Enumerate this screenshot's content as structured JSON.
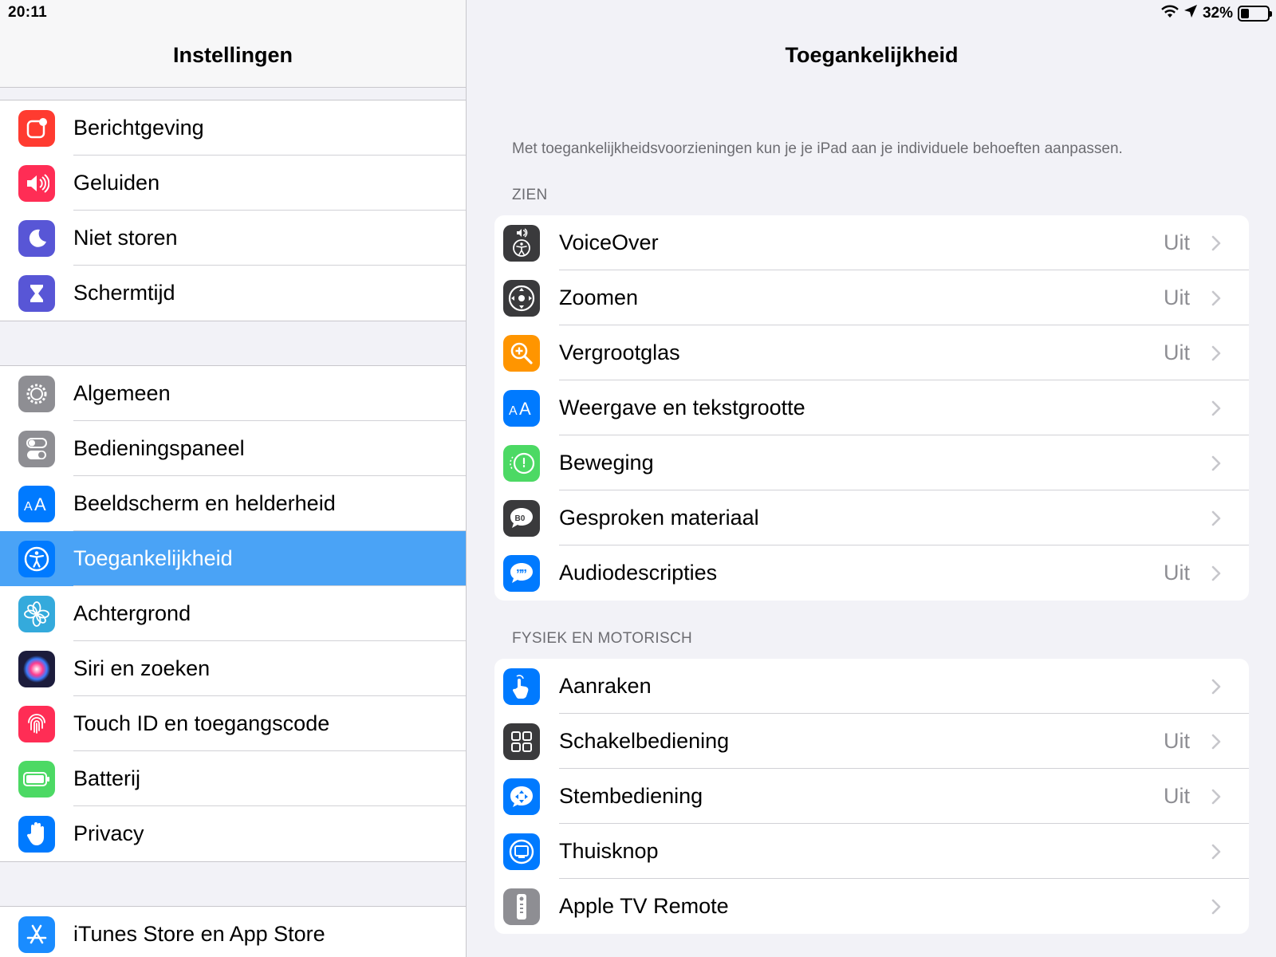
{
  "status": {
    "time": "20:11",
    "battery": "32%",
    "battery_level": 0.32
  },
  "sidebar": {
    "title": "Instellingen",
    "groups": [
      [
        {
          "label": "Berichtgeving",
          "icon": "notifications-icon",
          "color": "#ff3b30"
        },
        {
          "label": "Geluiden",
          "icon": "speaker-icon",
          "color": "#ff2d55"
        },
        {
          "label": "Niet storen",
          "icon": "moon-icon",
          "color": "#5856d6"
        },
        {
          "label": "Schermtijd",
          "icon": "hourglass-icon",
          "color": "#5856d6"
        }
      ],
      [
        {
          "label": "Algemeen",
          "icon": "gear-icon",
          "color": "#8e8e93"
        },
        {
          "label": "Bedieningspaneel",
          "icon": "toggles-icon",
          "color": "#8e8e93"
        },
        {
          "label": "Beeldscherm en helderheid",
          "icon": "text-size-icon",
          "color": "#007aff"
        },
        {
          "label": "Toegankelijkheid",
          "icon": "accessibility-icon",
          "color": "#007aff",
          "selected": true
        },
        {
          "label": "Achtergrond",
          "icon": "flower-icon",
          "color": "#34aadc"
        },
        {
          "label": "Siri en zoeken",
          "icon": "siri-icon",
          "color": "#1c1c3c"
        },
        {
          "label": "Touch ID en toegangscode",
          "icon": "fingerprint-icon",
          "color": "#ff2d55"
        },
        {
          "label": "Batterij",
          "icon": "battery-icon",
          "color": "#4cd964"
        },
        {
          "label": "Privacy",
          "icon": "hand-icon",
          "color": "#007aff"
        }
      ],
      [
        {
          "label": "iTunes Store en App Store",
          "icon": "app-store-icon",
          "color": "#1a8cff"
        }
      ]
    ]
  },
  "detail": {
    "title": "Toegankelijkheid",
    "description": "Met toegankelijkheidsvoorzieningen kun je je iPad aan je individuele behoeften aanpassen.",
    "sections": [
      {
        "header": "ZIEN",
        "items": [
          {
            "label": "VoiceOver",
            "value": "Uit",
            "icon": "voiceover-icon",
            "color": "#3a3a3c"
          },
          {
            "label": "Zoomen",
            "value": "Uit",
            "icon": "zoom-icon",
            "color": "#3a3a3c"
          },
          {
            "label": "Vergrootglas",
            "value": "Uit",
            "icon": "magnifier-icon",
            "color": "#ff9500"
          },
          {
            "label": "Weergave en tekstgrootte",
            "value": "",
            "icon": "text-size-icon",
            "color": "#007aff"
          },
          {
            "label": "Beweging",
            "value": "",
            "icon": "motion-icon",
            "color": "#4cd964"
          },
          {
            "label": "Gesproken materiaal",
            "value": "",
            "icon": "speech-bubble-icon",
            "color": "#3a3a3c"
          },
          {
            "label": "Audiodescripties",
            "value": "Uit",
            "icon": "quote-bubble-icon",
            "color": "#007aff"
          }
        ]
      },
      {
        "header": "FYSIEK EN MOTORISCH",
        "items": [
          {
            "label": "Aanraken",
            "value": "",
            "icon": "touch-hand-icon",
            "color": "#007aff"
          },
          {
            "label": "Schakelbediening",
            "value": "Uit",
            "icon": "grid-icon",
            "color": "#3a3a3c"
          },
          {
            "label": "Stembediening",
            "value": "Uit",
            "icon": "voice-control-icon",
            "color": "#007aff"
          },
          {
            "label": "Thuisknop",
            "value": "",
            "icon": "home-button-icon",
            "color": "#007aff"
          },
          {
            "label": "Apple TV Remote",
            "value": "",
            "icon": "remote-icon",
            "color": "#8e8e93"
          }
        ]
      }
    ]
  }
}
